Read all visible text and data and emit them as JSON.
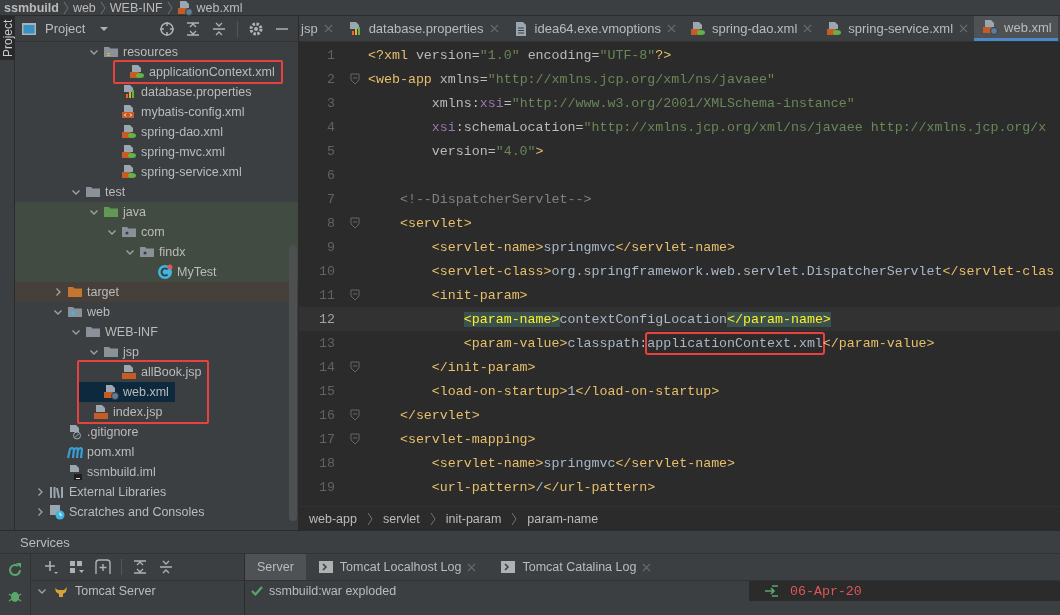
{
  "breadcrumb": [
    {
      "label": "ssmbuild",
      "kind": "project"
    },
    {
      "label": "web",
      "kind": "folder"
    },
    {
      "label": "WEB-INF",
      "kind": "folder"
    },
    {
      "label": "web.xml",
      "kind": "web-xml"
    }
  ],
  "side_tabs": [
    {
      "label": "Project",
      "selected": true
    }
  ],
  "project_panel": {
    "title": "Project",
    "tree": [
      {
        "children": [
          {
            "children": [
              {
                "children": [
                  {
                    "label": "resources",
                    "kind": "folder-res",
                    "expanded": true,
                    "selected": false,
                    "highlighted": false,
                    "children": [
                      {
                        "label": "applicationContext.xml",
                        "kind": "spring-xml",
                        "selected": false,
                        "highlighted": true
                      },
                      {
                        "label": "database.properties",
                        "kind": "properties",
                        "selected": false,
                        "highlighted": false
                      },
                      {
                        "label": "mybatis-config.xml",
                        "kind": "xml",
                        "selected": false,
                        "highlighted": false
                      },
                      {
                        "label": "spring-dao.xml",
                        "kind": "spring-xml",
                        "selected": false,
                        "highlighted": false
                      },
                      {
                        "label": "spring-mvc.xml",
                        "kind": "spring-xml",
                        "selected": false,
                        "highlighted": false
                      },
                      {
                        "label": "spring-service.xml",
                        "kind": "spring-xml",
                        "selected": false,
                        "highlighted": false
                      }
                    ]
                  }
                ]
              },
              {
                "label": "test",
                "kind": "folder",
                "expanded": true,
                "selected": false,
                "highlighted": false,
                "children": [
                  {
                    "label": "java",
                    "kind": "folder-test",
                    "expanded": true,
                    "color": "#414b41",
                    "selected": false,
                    "highlighted": false,
                    "children": [
                      {
                        "label": "com",
                        "kind": "package",
                        "expanded": true,
                        "color": "#414b41",
                        "selected": false,
                        "highlighted": false,
                        "children": [
                          {
                            "label": "findx",
                            "kind": "package",
                            "expanded": true,
                            "color": "#414b41",
                            "selected": false,
                            "highlighted": false,
                            "children": [
                              {
                                "label": "MyTest",
                                "kind": "class",
                                "color": "#414b41",
                                "selected": false,
                                "highlighted": false
                              }
                            ]
                          }
                        ]
                      }
                    ]
                  }
                ]
              }
            ]
          },
          {
            "label": "target",
            "kind": "folder-excluded",
            "expanded": false,
            "color": "#46403a",
            "selected": false,
            "highlighted": false
          },
          {
            "label": "web",
            "kind": "folder-web",
            "expanded": true,
            "selected": false,
            "highlighted": false,
            "children": [
              {
                "label": "WEB-INF",
                "kind": "folder",
                "expanded": true,
                "selected": false,
                "highlighted": false,
                "children": [
                  {
                    "label": "jsp",
                    "kind": "folder",
                    "expanded": true,
                    "selected": false,
                    "highlighted": false,
                    "children": [
                      {
                        "label": "allBook.jsp",
                        "kind": "jsp",
                        "selected": false,
                        "highlighted": true
                      }
                    ]
                  },
                  {
                    "label": "web.xml",
                    "kind": "web-xml",
                    "selected": true,
                    "highlighted": true
                  }
                ]
              },
              {
                "label": "index.jsp",
                "kind": "jsp",
                "selected": false,
                "highlighted": true
              }
            ]
          },
          {
            "label": ".gitignore",
            "kind": "gitignore",
            "selected": false,
            "highlighted": false
          },
          {
            "label": "pom.xml",
            "kind": "maven",
            "selected": false,
            "highlighted": false
          },
          {
            "label": "ssmbuild.iml",
            "kind": "iml",
            "selected": false,
            "highlighted": false
          }
        ]
      },
      {
        "label": "External Libraries",
        "kind": "libraries",
        "expanded": false,
        "selected": false,
        "highlighted": false
      },
      {
        "label": "Scratches and Consoles",
        "kind": "scratches",
        "expanded": false,
        "selected": false,
        "highlighted": false
      }
    ]
  },
  "editor_tabs": [
    {
      "label": "jsp",
      "kind": "none",
      "selected": false
    },
    {
      "label": "database.properties",
      "kind": "properties",
      "selected": false
    },
    {
      "label": "idea64.exe.vmoptions",
      "kind": "text",
      "selected": false
    },
    {
      "label": "spring-dao.xml",
      "kind": "spring-xml",
      "selected": false
    },
    {
      "label": "spring-service.xml",
      "kind": "spring-xml",
      "selected": false
    },
    {
      "label": "web.xml",
      "kind": "web-xml",
      "selected": true
    }
  ],
  "code_lines": [
    {
      "number": "1",
      "fold": false,
      "current": false,
      "tokens": [
        {
          "kind": "tag",
          "text": "<?xml "
        },
        {
          "kind": "attr",
          "text": "version="
        },
        {
          "kind": "string",
          "text": "\"1.0\" "
        },
        {
          "kind": "attr",
          "text": "encoding="
        },
        {
          "kind": "string",
          "text": "\"UTF-8\""
        },
        {
          "kind": "tag",
          "text": "?>"
        }
      ]
    },
    {
      "number": "2",
      "fold": true,
      "current": false,
      "tokens": [
        {
          "kind": "tag",
          "text": "<web-app "
        },
        {
          "kind": "attr",
          "text": "xmlns="
        },
        {
          "kind": "string",
          "text": "\"http://xmlns.jcp.org/xml/ns/javaee\""
        }
      ]
    },
    {
      "number": "3",
      "fold": false,
      "current": false,
      "tokens": [
        {
          "kind": "attr",
          "text": "        xmlns:"
        },
        {
          "kind": "ns",
          "text": "xsi"
        },
        {
          "kind": "attr",
          "text": "="
        },
        {
          "kind": "string",
          "text": "\"http://www.w3.org/2001/XMLSchema-instance\""
        }
      ]
    },
    {
      "number": "4",
      "fold": false,
      "current": false,
      "tokens": [
        {
          "kind": "ns",
          "text": "        xsi"
        },
        {
          "kind": "attr",
          "text": ":schemaLocation="
        },
        {
          "kind": "string",
          "text": "\"http://xmlns.jcp.org/xml/ns/javaee http://xmlns.jcp.org/x"
        }
      ]
    },
    {
      "number": "5",
      "fold": false,
      "current": false,
      "tokens": [
        {
          "kind": "attr",
          "text": "        version="
        },
        {
          "kind": "string",
          "text": "\"4.0\""
        },
        {
          "kind": "tag",
          "text": ">"
        }
      ]
    },
    {
      "number": "6",
      "fold": false,
      "current": false
    },
    {
      "number": "7",
      "fold": false,
      "current": false,
      "tokens": [
        {
          "kind": "comment",
          "text": "    <!--DispatcherServlet-->"
        }
      ]
    },
    {
      "number": "8",
      "fold": true,
      "current": false,
      "tokens": [
        {
          "kind": "tag",
          "text": "    <servlet>"
        }
      ]
    },
    {
      "number": "9",
      "fold": false,
      "current": false,
      "tokens": [
        {
          "kind": "tag",
          "text": "        <servlet-name>"
        },
        {
          "kind": "text",
          "text": "springmvc"
        },
        {
          "kind": "tag",
          "text": "</servlet-name>"
        }
      ]
    },
    {
      "number": "10",
      "fold": false,
      "current": false,
      "tokens": [
        {
          "kind": "tag",
          "text": "        <servlet-class>"
        },
        {
          "kind": "text",
          "text": "org.springframework.web.servlet.DispatcherServlet"
        },
        {
          "kind": "tag",
          "text": "</servlet-clas"
        }
      ]
    },
    {
      "number": "11",
      "fold": true,
      "current": false,
      "tokens": [
        {
          "kind": "tag",
          "text": "        <init-param>"
        }
      ]
    },
    {
      "number": "12",
      "fold": false,
      "current": true,
      "tokens": [
        {
          "kind": "tag-match",
          "text": "            <param-name>"
        },
        {
          "kind": "text",
          "text": "contextConfigLocation"
        },
        {
          "kind": "tag-match",
          "text": "</param-name>"
        }
      ]
    },
    {
      "number": "13",
      "fold": false,
      "current": false,
      "tokens": [
        {
          "kind": "tag",
          "text": "            <param-value>"
        },
        {
          "kind": "text",
          "text": "classpath:"
        },
        {
          "kind": "text-boxed",
          "text": "applicationContext.xml"
        },
        {
          "kind": "tag",
          "text": "</param-value>"
        }
      ]
    },
    {
      "number": "14",
      "fold": true,
      "current": false,
      "tokens": [
        {
          "kind": "tag",
          "text": "        </init-param>"
        }
      ]
    },
    {
      "number": "15",
      "fold": false,
      "current": false,
      "tokens": [
        {
          "kind": "tag",
          "text": "        <load-on-startup>"
        },
        {
          "kind": "text",
          "text": "1"
        },
        {
          "kind": "tag",
          "text": "</load-on-startup>"
        }
      ]
    },
    {
      "number": "16",
      "fold": true,
      "current": false,
      "tokens": [
        {
          "kind": "tag",
          "text": "    </servlet>"
        }
      ]
    },
    {
      "number": "17",
      "fold": true,
      "current": false,
      "tokens": [
        {
          "kind": "tag",
          "text": "    <servlet-mapping>"
        }
      ]
    },
    {
      "number": "18",
      "fold": false,
      "current": false,
      "tokens": [
        {
          "kind": "tag",
          "text": "        <servlet-name>"
        },
        {
          "kind": "text",
          "text": "springmvc"
        },
        {
          "kind": "tag",
          "text": "</servlet-name>"
        }
      ]
    },
    {
      "number": "19",
      "fold": false,
      "current": false,
      "tokens": [
        {
          "kind": "tag",
          "text": "        <url-pattern>"
        },
        {
          "kind": "text",
          "text": "/"
        },
        {
          "kind": "tag",
          "text": "</url-pattern>"
        }
      ]
    }
  ],
  "editor_breadcrumb": [
    "web-app",
    "servlet",
    "init-param",
    "param-name"
  ],
  "services": {
    "title": "Services",
    "tree": [
      {
        "label": "Tomcat Server",
        "expanded": true
      }
    ],
    "tabs": [
      {
        "label": "Server",
        "kind": "none",
        "selected": true
      },
      {
        "label": "Tomcat Localhost Log",
        "kind": "log",
        "selected": false
      },
      {
        "label": "Tomcat Catalina Log",
        "kind": "log",
        "selected": false
      }
    ],
    "deployments": [
      "ssmbuild:war exploded"
    ],
    "log_lines": [
      "06-Apr-20"
    ]
  }
}
